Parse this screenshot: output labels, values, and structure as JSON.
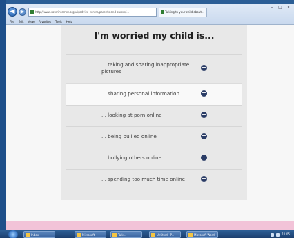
{
  "browser": {
    "url": "http://www.saferinternet.org.uk/advice-centre/parents-and-carers/...",
    "tab_title": "Talking to your child about...",
    "menu": [
      "File",
      "Edit",
      "View",
      "Favorites",
      "Tools",
      "Help"
    ],
    "window_controls": [
      "–",
      "□",
      "×"
    ],
    "back_glyph": "◀",
    "forward_glyph": "▶"
  },
  "panel": {
    "title": "I'm worried my child is...",
    "items": [
      {
        "label": "... taking and sharing inappropriate pictures",
        "icon": "plus-icon"
      },
      {
        "label": "... sharing personal information",
        "icon": "plus-icon"
      },
      {
        "label": "... looking at porn online",
        "icon": "plus-icon"
      },
      {
        "label": "... being bullied online",
        "icon": "plus-icon"
      },
      {
        "label": "... bullying others online",
        "icon": "plus-icon"
      },
      {
        "label": "... spending too much time online",
        "icon": "plus-icon"
      }
    ],
    "plus_glyph": "+"
  },
  "taskbar": {
    "items": [
      "Inbox",
      "Microsoft",
      "Talk...",
      "Untitled - P...",
      "Microsoft Word",
      "Document1"
    ],
    "clock": "11:05"
  },
  "colors": {
    "panel_bg": "#e8e8e8",
    "icon_bg": "#2a3c66",
    "footer_pink": "#f2c3d8"
  }
}
